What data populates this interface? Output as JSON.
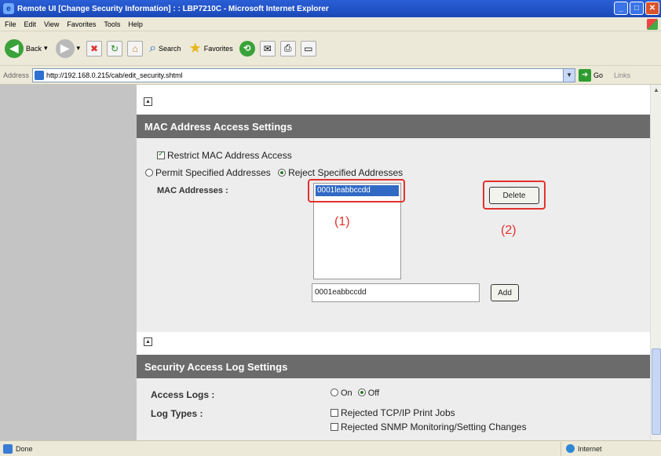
{
  "window": {
    "title": "Remote UI [Change Security Information] : : LBP7210C - Microsoft Internet Explorer",
    "controls": [
      "minimize-icon",
      "maximize-icon",
      "close-icon"
    ]
  },
  "menu": [
    "File",
    "Edit",
    "View",
    "Favorites",
    "Tools",
    "Help"
  ],
  "toolbar": {
    "back": "Back",
    "search": "Search",
    "favorites": "Favorites"
  },
  "address": {
    "label": "Address",
    "url": "http://192.168.0.215/cab/edit_security.shtml",
    "go": "Go",
    "links": "Links"
  },
  "mac_section": {
    "header": "MAC Address Access Settings",
    "restrict_label": "Restrict MAC Address Access",
    "restrict_checked": true,
    "permit_label": "Permit Specified Addresses",
    "reject_label": "Reject Specified Addresses",
    "selected_mode": "reject",
    "addresses_label": "MAC Addresses :",
    "list_items": [
      "0001leabbccdd"
    ],
    "delete_button": "Delete",
    "new_address_value": "0001eabbccdd",
    "add_button": "Add",
    "callout_1": "(1)",
    "callout_2": "(2)"
  },
  "log_section": {
    "header": "Security Access Log Settings",
    "access_logs_label": "Access Logs :",
    "on_label": "On",
    "off_label": "Off",
    "selected": "off",
    "log_types_label": "Log Types :",
    "log_types": [
      "Rejected TCP/IP Print Jobs",
      "Rejected SNMP Monitoring/Setting Changes"
    ]
  },
  "status": {
    "text": "Done",
    "zone": "Internet"
  },
  "colors": {
    "header_bg": "#6b6b6b",
    "panel_bg": "#ededed",
    "sidebar_bg": "#c4c4c4",
    "callout_red": "#e2322e",
    "title_blue": "#2a5fd6"
  }
}
